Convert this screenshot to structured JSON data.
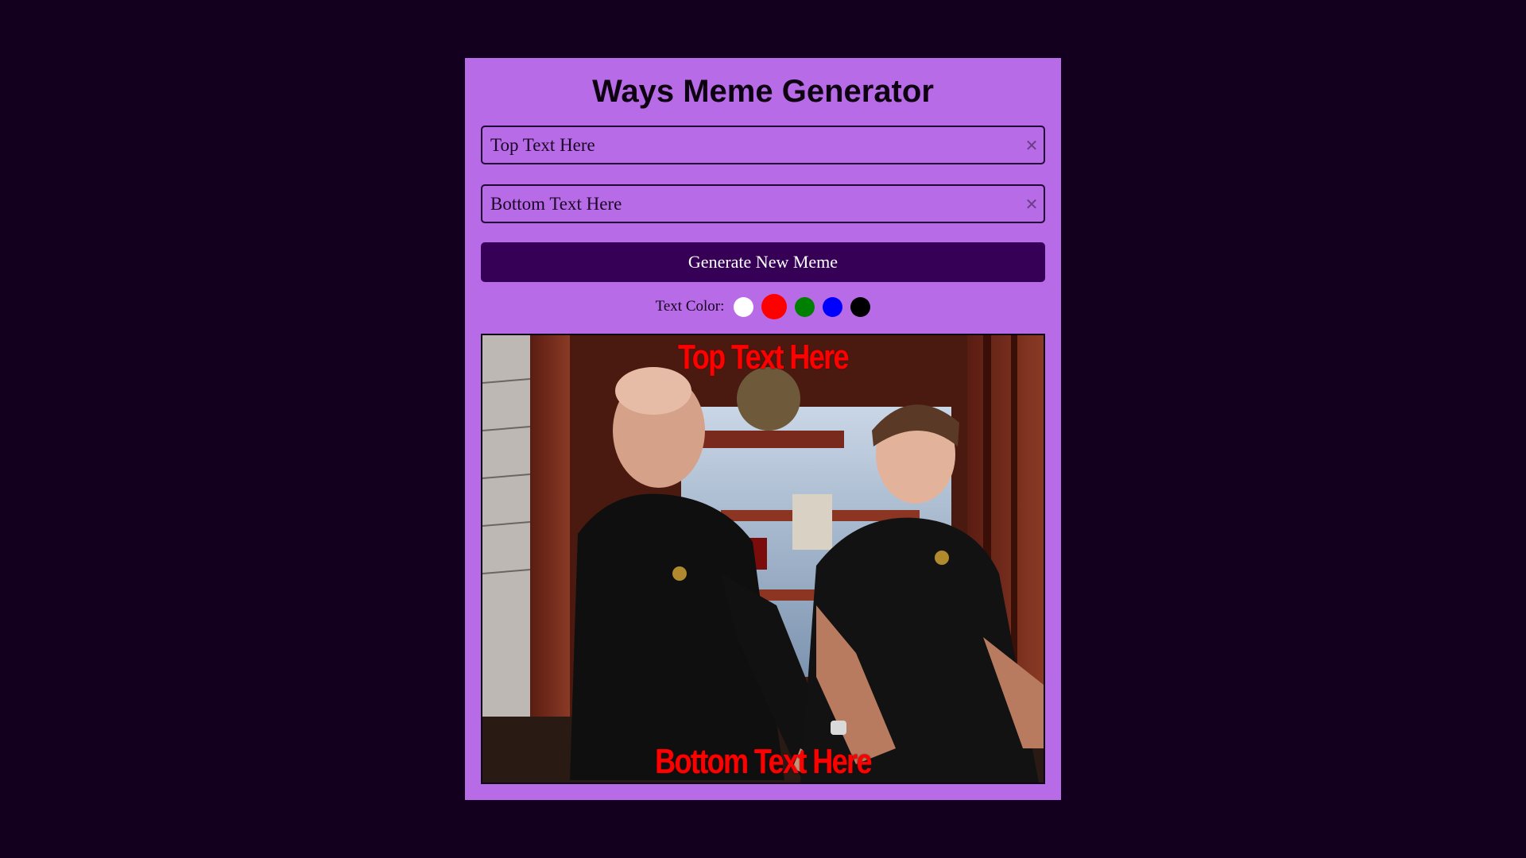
{
  "app": {
    "title": "Ways Meme Generator"
  },
  "inputs": {
    "top_text": "Top Text Here",
    "bottom_text": "Bottom Text Here",
    "clear_glyph": "✕"
  },
  "generate_button": {
    "label": "Generate New Meme"
  },
  "text_color": {
    "label": "Text Color:",
    "selected": "#ff0000",
    "options": [
      {
        "name": "white",
        "hex": "#ffffff"
      },
      {
        "name": "red",
        "hex": "#ff0000"
      },
      {
        "name": "green",
        "hex": "#008000"
      },
      {
        "name": "blue",
        "hex": "#0000ff"
      },
      {
        "name": "black",
        "hex": "#000000"
      }
    ]
  },
  "meme": {
    "top_text": "Top Text Here",
    "bottom_text": "Bottom Text Here",
    "image_subject": "two men in black polo shirts at a pawn shop counter"
  }
}
